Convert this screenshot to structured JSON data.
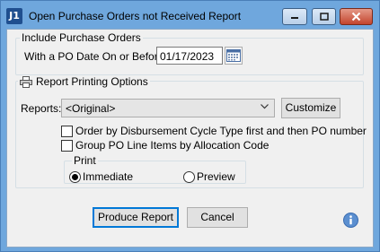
{
  "window": {
    "app_icon": "J1",
    "title": "Open Purchase Orders not Received Report"
  },
  "include_group": {
    "legend": "Include Purchase Orders",
    "po_date_label": "With a PO Date On or Before :",
    "po_date_value": "01/17/2023"
  },
  "report_group": {
    "legend": "Report Printing Options",
    "reports_label": "Reports:",
    "reports_selected": "<Original>",
    "customize_label": "Customize",
    "options": [
      {
        "label": "Order by Disbursement Cycle Type first and then PO number",
        "checked": false
      },
      {
        "label": "Group PO Line Items by Allocation Code",
        "checked": false
      }
    ]
  },
  "print_group": {
    "legend": "Print",
    "immediate_label": "Immediate",
    "preview_label": "Preview",
    "selected": "Immediate"
  },
  "buttons": {
    "produce_label": "Produce Report",
    "cancel_label": "Cancel"
  },
  "colors": {
    "titlebar": "#6fa7dd",
    "dialog_bg": "#f0f0f0",
    "default_button_border": "#0078d7",
    "info_icon": "#5b8fd0"
  },
  "icons": [
    "j1-app-icon",
    "minimize-icon",
    "maximize-icon",
    "close-icon",
    "calendar-icon",
    "printer-icon",
    "chevron-down-icon",
    "info-icon"
  ]
}
